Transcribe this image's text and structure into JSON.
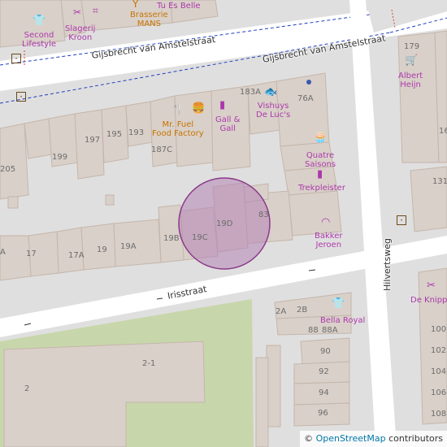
{
  "streets": {
    "gijsbrecht_left": "Gijsbrecht van Amstelstraat",
    "gijsbrecht_right": "Gijsbrecht van Amstelstraat",
    "irisstraat": "Irisstraat",
    "hilvertsweg": "Hilvertsweg"
  },
  "pois": {
    "second_lifestyle": "Second\nLifestyle",
    "slagerij_kroon": "Slagerij\nKroon",
    "tu_es_belle": "Tu Es Belle",
    "brasserie_mans": "Brasserie\nMANS",
    "mr_fuel": "Mr. Fuel\nFood Factory",
    "gall_gall": "Gall &\nGall",
    "vishuys": "Vishuys\nDe Luc's",
    "quatre_saisons": "Quatre\nSaisons",
    "trekpleister": "Trekpleister",
    "bakker_jeroen": "Bakker\nJeroen",
    "albert_heijn": "Albert\nHeijn",
    "bella_royal": "Bella Royal",
    "de_knipper": "De Knippe"
  },
  "house_numbers": {
    "n179": "179",
    "n183a": "183A",
    "n76a": "76A",
    "n197": "197",
    "n195": "195",
    "n193": "193",
    "n187c": "187C",
    "n199": "199",
    "n205": "205",
    "n19d": "19D",
    "n19c": "19C",
    "n19b": "19B",
    "n19a": "19A",
    "n19": "19",
    "n17a": "17A",
    "n17": "17",
    "nA": "A",
    "n83": "83",
    "n2a": "2A",
    "n2b": "2B",
    "n88": "88",
    "n88a": "88A",
    "n90": "90",
    "n92": "92",
    "n94": "94",
    "n96": "96",
    "n2_1": "2-1",
    "n2": "2",
    "n16": "16",
    "n131": "131",
    "n100": "100",
    "n102": "102",
    "n104": "104",
    "n106": "106",
    "n108": "108"
  },
  "attribution": {
    "symbol": "©",
    "link": "OpenStreetMap",
    "suffix": "contributors"
  },
  "colors": {
    "background": "#e0dfdf",
    "building": "#d9d0c9",
    "building_stroke": "#c4b6ab",
    "road": "#ffffff",
    "park": "#c8d7ab",
    "path_blue": "#1f3fbf",
    "highlight_fill": "#b584b5",
    "highlight_stroke": "#8a3a8a",
    "shop_pink": "#ac39ac",
    "food_orange": "#c77400"
  },
  "map_icons": [
    "shop-bag-icon",
    "scissors-icon",
    "bus-stop-icon",
    "cocktail-icon",
    "fastfood-icon",
    "bottle-icon",
    "fish-icon",
    "cake-icon",
    "bakery-icon",
    "shopping-cart-icon",
    "clothes-icon",
    "dot-icon"
  ]
}
